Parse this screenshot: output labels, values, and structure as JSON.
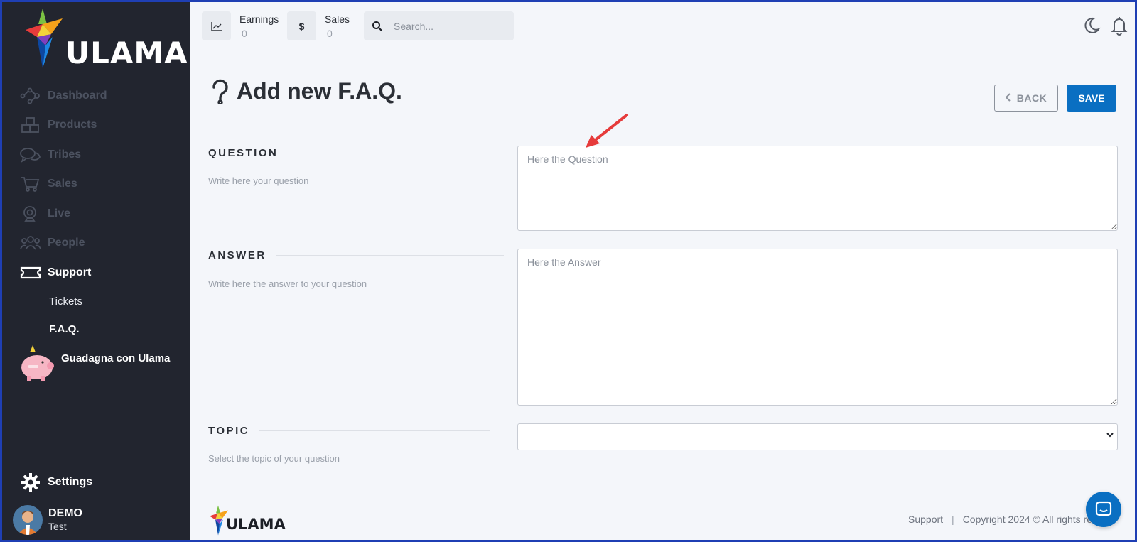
{
  "brand": {
    "name": "ULAMA"
  },
  "topbar": {
    "earnings": {
      "label": "Earnings",
      "value": "0"
    },
    "sales": {
      "label": "Sales",
      "value": "0",
      "icon": "$"
    },
    "search": {
      "placeholder": "Search..."
    }
  },
  "sidebar": {
    "items": [
      {
        "label": "Dashboard",
        "icon": "network-icon"
      },
      {
        "label": "Products",
        "icon": "boxes-icon"
      },
      {
        "label": "Tribes",
        "icon": "chat-bubbles-icon"
      },
      {
        "label": "Sales",
        "icon": "cart-icon"
      },
      {
        "label": "Live",
        "icon": "webcam-icon"
      },
      {
        "label": "People",
        "icon": "people-icon"
      },
      {
        "label": "Support",
        "icon": "ticket-icon"
      }
    ],
    "support_sub": [
      {
        "label": "Tickets"
      },
      {
        "label": "F.A.Q."
      }
    ],
    "promo": {
      "label": "Guadagna con Ulama"
    },
    "settings": {
      "label": "Settings"
    },
    "user": {
      "name": "DEMO",
      "sub": "Test"
    }
  },
  "page": {
    "title": "Add new F.A.Q.",
    "back_label": "BACK",
    "save_label": "SAVE"
  },
  "form": {
    "question": {
      "title": "QUESTION",
      "description": "Write here your question",
      "placeholder": "Here the Question"
    },
    "answer": {
      "title": "ANSWER",
      "description": "Write here the answer to your question",
      "placeholder": "Here the Answer"
    },
    "topic": {
      "title": "TOPIC",
      "description": "Select the topic of your question",
      "selected": ""
    }
  },
  "footer": {
    "support": "Support",
    "separator": "|",
    "copyright": "Copyright 2024 © All rights res"
  },
  "colors": {
    "sidebar_bg": "#22252f",
    "accent": "#0a6fc2",
    "annotation": "#e63b3b"
  }
}
